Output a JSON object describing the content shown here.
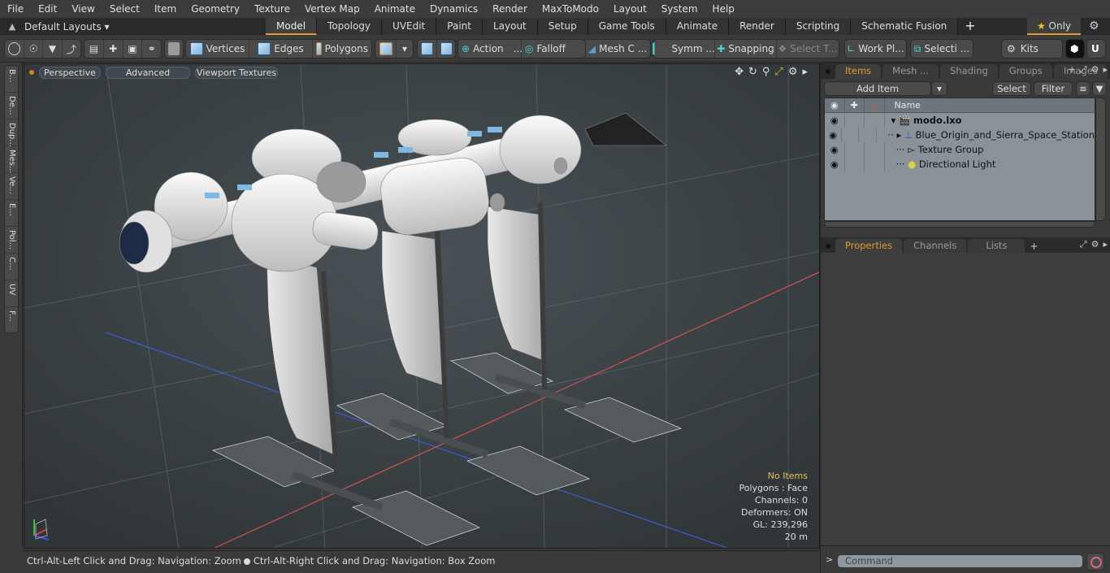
{
  "menu": [
    "File",
    "Edit",
    "View",
    "Select",
    "Item",
    "Geometry",
    "Texture",
    "Vertex Map",
    "Animate",
    "Dynamics",
    "Render",
    "MaxToModo",
    "Layout",
    "System",
    "Help"
  ],
  "layout_bar": {
    "layouts_label": "Default Layouts ▾",
    "tabs": [
      "Model",
      "Topology",
      "UVEdit",
      "Paint",
      "Layout",
      "Setup",
      "Game Tools",
      "Animate",
      "Render",
      "Scripting",
      "Schematic Fusion"
    ],
    "active_tab": "Model",
    "plus": "+",
    "only_label": "Only",
    "star": "★",
    "gear": "⚙"
  },
  "toolbar": {
    "vertices": "Vertices",
    "edges": "Edges",
    "polygons": "Polygons",
    "action": "Action",
    "falloff": "Falloff",
    "mesh": "Mesh C ...",
    "symmetry": "Symm ...",
    "snapping": "Snapping",
    "select_tool": "Select T...",
    "work_plane": "Work Pl...",
    "selection": "Selecti ...",
    "kits": "Kits",
    "ellipsis": "..."
  },
  "left_strip": [
    "B...",
    "De...",
    "Dup...",
    "Mes...",
    "Ve...",
    "E...",
    "Pol...",
    "C...",
    "UV",
    "F..."
  ],
  "viewport": {
    "perspective": "Perspective",
    "advanced": "Advanced",
    "viewport_textures": "Viewport Textures",
    "stats": {
      "selection": "No Items",
      "polygons": "Polygons : Face",
      "channels": "Channels: 0",
      "deformers": "Deformers: ON",
      "gl": "GL: 239,296",
      "scale": "20 m"
    }
  },
  "status": {
    "left": "Ctrl-Alt-Left Click and Drag: Navigation: Zoom",
    "right": "Ctrl-Alt-Right Click and Drag: Navigation: Box Zoom"
  },
  "items_panel": {
    "tabs": [
      "Items",
      "Mesh ...",
      "Shading",
      "Groups",
      "Images"
    ],
    "active_tab": "Items",
    "add_item": "Add Item",
    "select": "Select",
    "filter": "Filter",
    "name_header": "Name",
    "rows": [
      {
        "name": "modo.lxo",
        "indent": 0,
        "bold": true,
        "expander": "▾"
      },
      {
        "name": "Blue_Origin_and_Sierra_Space_Station",
        "indent": 1,
        "bold": false,
        "expander": "▸"
      },
      {
        "name": "Texture Group",
        "indent": 1,
        "bold": false,
        "expander": ""
      },
      {
        "name": "Directional Light",
        "indent": 1,
        "bold": false,
        "expander": ""
      }
    ]
  },
  "props_panel": {
    "tabs": [
      "Properties",
      "Channels",
      "Lists"
    ],
    "active_tab": "Properties"
  },
  "command": {
    "prompt": ">",
    "placeholder": "Command"
  },
  "colors": {
    "accent": "#e09a30",
    "viewport_bg": "#3d4448",
    "tree_bg": "#8a9299"
  }
}
